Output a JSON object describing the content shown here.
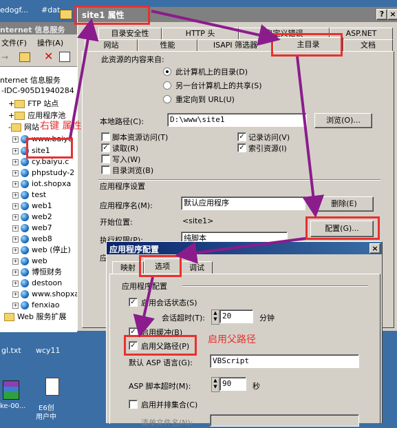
{
  "background_window": {
    "top_texts": [
      "edogf...",
      "#dat"
    ],
    "title_fragment": "nternet 信息服务",
    "menu": [
      "文件(F)",
      "操作(A)"
    ],
    "tree": {
      "root": "nternet 信息服务",
      "server": "IDC-905D1940284 (",
      "ftp": "FTP 站点",
      "app_pools": "应用程序池",
      "websites": "网站",
      "sites": [
        "www.baiyu",
        "site1",
        "cy.baiyu.c",
        "phpstudy-2",
        "iot.shopxa",
        "test",
        "web1",
        "web2",
        "web7",
        "web8",
        "web (停止)",
        "web",
        "博恒财务",
        "destoon",
        "www.shopxa",
        "fenxiao"
      ],
      "web_ext": "Web 服务扩展"
    },
    "desktop_files": [
      "gl.txt",
      "wcy11"
    ],
    "desktop_icons": [
      "ke-00...",
      "E6创",
      "用户中"
    ]
  },
  "props_dialog": {
    "title": "site1 属性",
    "help_btn": "?",
    "close_btn": "×",
    "tabs_row1": [
      "目录安全性",
      "HTTP 头",
      "自定义错误",
      "ASP.NET"
    ],
    "tabs_row2": [
      "网站",
      "性能",
      "ISAPI 筛选器",
      "主目录",
      "文档"
    ],
    "content_source_label": "此资源的内容来自:",
    "radio_options": [
      "此计算机上的目录(D)",
      "另一台计算机上的共享(S)",
      "重定向到 URL(U)"
    ],
    "local_path_label": "本地路径(C):",
    "local_path_value": "D:\\www\\site1",
    "browse_btn": "浏览(O)...",
    "checkboxes_left": [
      "脚本资源访问(T)",
      "读取(R)",
      "写入(W)",
      "目录浏览(B)"
    ],
    "checkboxes_right": [
      "记录访问(V)",
      "索引资源(I)"
    ],
    "app_settings_label": "应用程序设置",
    "app_name_label": "应用程序名(M):",
    "app_name_value": "默认应用程序",
    "remove_btn": "删除(E)",
    "start_point_label": "开始位置:",
    "start_point_value": "<site1>",
    "config_btn": "配置(G)...",
    "exec_perm_label": "执行权限(P):",
    "exec_perm_value": "纯脚本",
    "app_pool_label_fragment": "应"
  },
  "config_dialog": {
    "title": "应用程序配置",
    "close_btn": "×",
    "tabs": [
      "映射",
      "选项",
      "调试"
    ],
    "group_label": "应用程序配置",
    "session_state": "启用会话状态(S)",
    "session_timeout_label": "会话超时(T):",
    "session_timeout_value": "20",
    "session_timeout_unit": "分钟",
    "buffering": "启用缓冲(B)",
    "parent_paths": "启用父路径(P)",
    "default_lang_label": "默认 ASP 语言(G):",
    "default_lang_value": "VBScript",
    "script_timeout_label": "ASP 脚本超时(M):",
    "script_timeout_value": "90",
    "script_timeout_unit": "秒",
    "side_by_side": "启用并排集合(C)",
    "bottom_fragment": "清单文件名(N):"
  },
  "annotations": {
    "right_click_props": "右键 属性",
    "enable_parent_paths": "启用父路径"
  },
  "colors": {
    "annotation_red": "#e8302f",
    "arrow_purple": "#8b1c8c",
    "title_active": "#0a246a",
    "title_inactive": "#808080",
    "desktop": "#3a6ea5",
    "dialog_face": "#d4d0c8"
  }
}
